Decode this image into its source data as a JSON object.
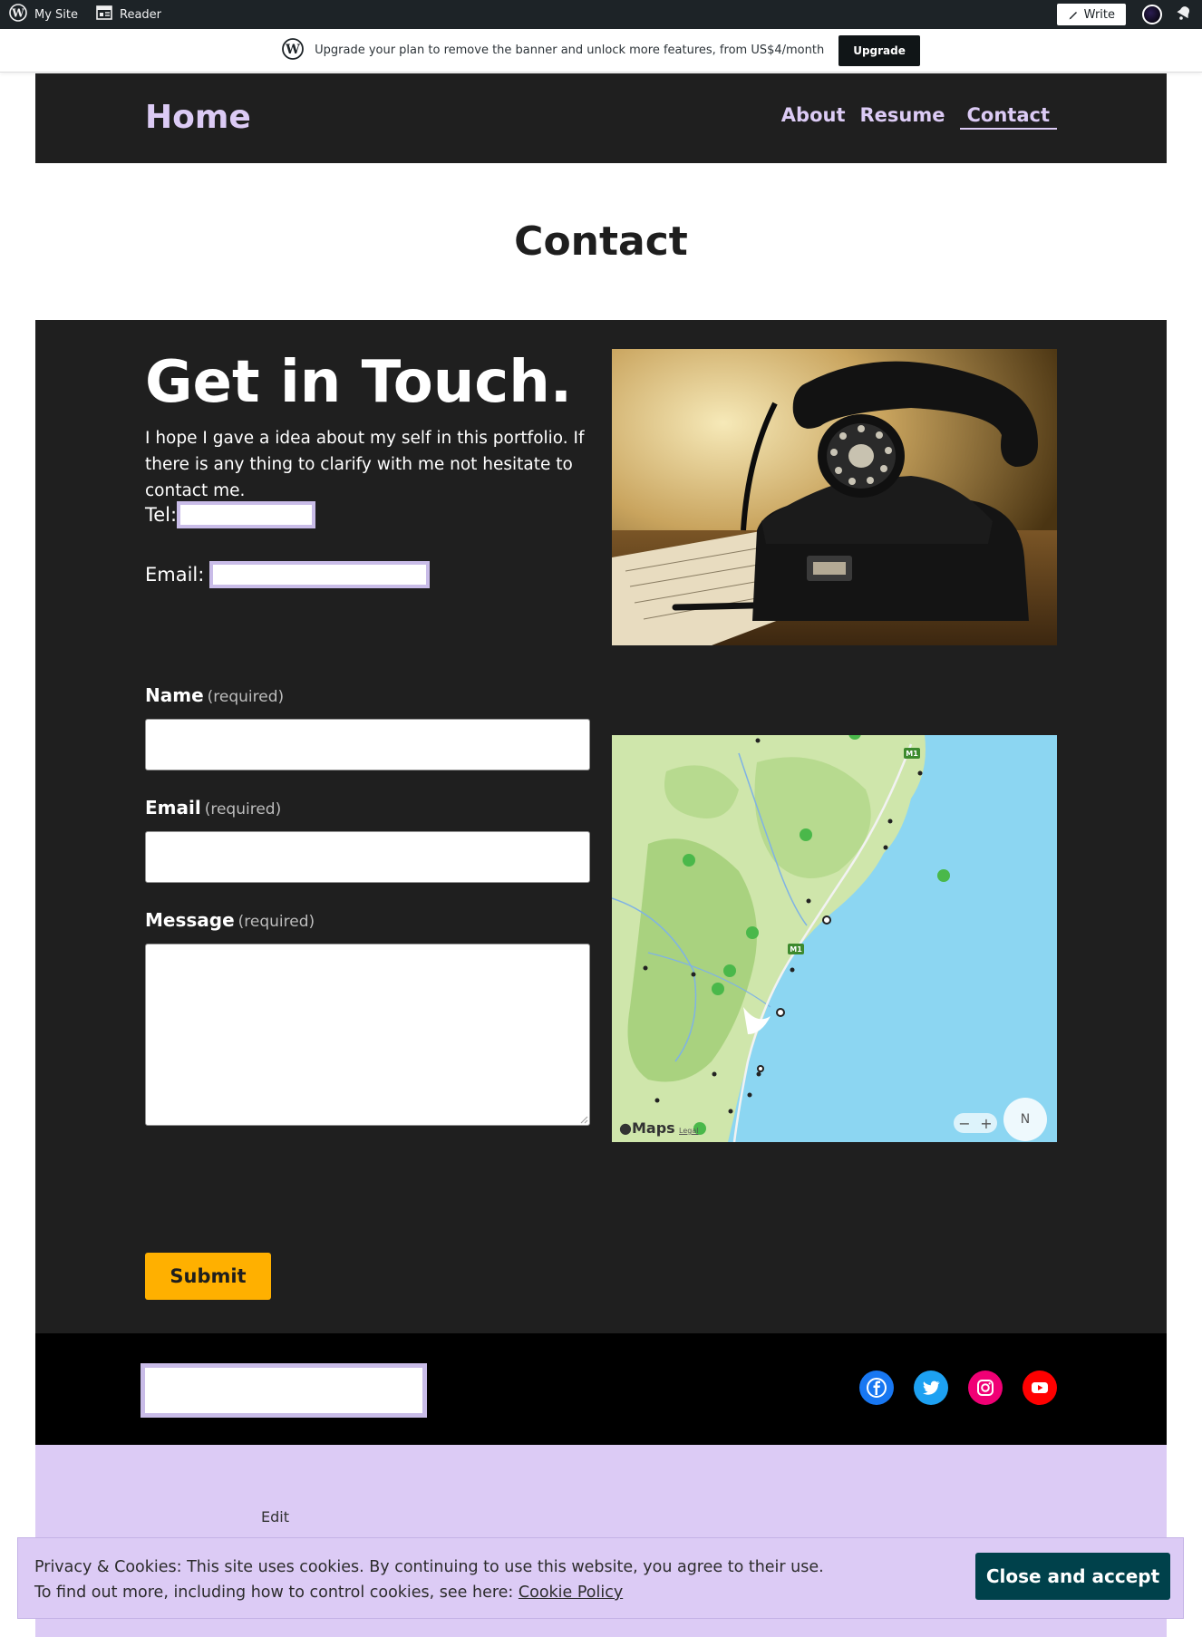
{
  "admin_bar": {
    "my_site": "My Site",
    "reader": "Reader",
    "write": "Write"
  },
  "banner": {
    "text": "Upgrade your plan to remove the banner and unlock more features, from US$4/month",
    "button": "Upgrade"
  },
  "header": {
    "site_title": "Home",
    "nav": [
      "About",
      "Resume",
      "Contact"
    ],
    "active_nav": "Contact"
  },
  "page": {
    "title": "Contact"
  },
  "contact": {
    "heading": "Get in Touch.",
    "intro": "I hope I gave a idea about my self in this portfolio. If there is any thing to clarify with me not hesitate to contact me.",
    "tel_label": "Tel:",
    "email_label": "Email:"
  },
  "form": {
    "name_label": "Name",
    "email_label": "Email",
    "message_label": "Message",
    "required": "(required)",
    "submit": "Submit"
  },
  "map": {
    "brand": "Maps",
    "legal": "Legal",
    "zoom_minus": "−",
    "zoom_plus": "+",
    "compass": "N",
    "highway_badge": "M1"
  },
  "footer": {
    "socials": [
      "facebook",
      "twitter",
      "instagram",
      "youtube"
    ],
    "edit": "Edit"
  },
  "cookie": {
    "line1": "Privacy & Cookies: This site uses cookies. By continuing to use this website, you agree to their use.",
    "line2": "To find out more, including how to control cookies, see here:",
    "link": "Cookie Policy",
    "button": "Close and accept"
  },
  "colors": {
    "accent": "#dccbf5",
    "dark": "#1f1f1f",
    "submit": "#ffb000",
    "cookie_button": "#00414b"
  }
}
